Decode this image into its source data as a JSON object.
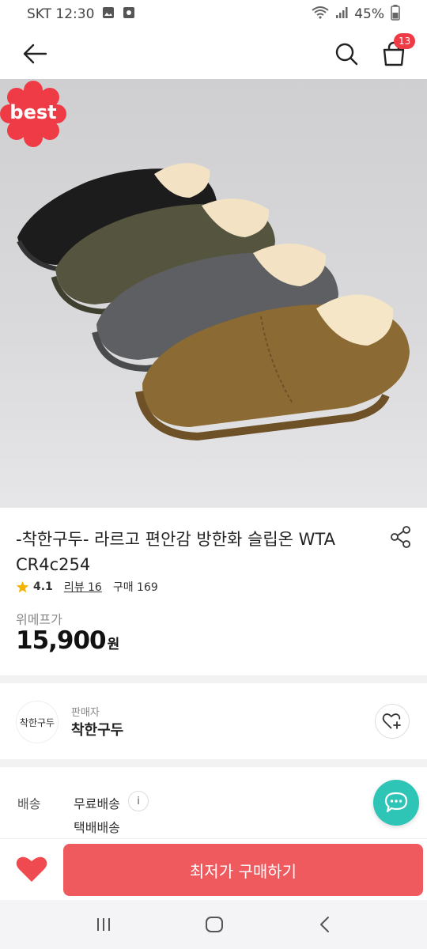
{
  "status_bar": {
    "carrier_time": "SKT 12:30",
    "battery": "45%"
  },
  "header": {
    "back_icon": "arrow-left-icon",
    "search_icon": "search-icon",
    "cart_icon": "shopping-bag-icon",
    "cart_count": "13"
  },
  "product": {
    "badge": "best",
    "title": "-착한구두- 라르고 편안감 방한화 슬립온 WTA CR4c254",
    "rating": "4.1",
    "review_text": "리뷰 16",
    "purchase_text": "구매 169",
    "price_label": "위메프가",
    "price": "15,900",
    "price_unit": "원"
  },
  "seller": {
    "logo_text": "착한구두",
    "label": "판매자",
    "name": "착한구두"
  },
  "shipping": {
    "label": "배송",
    "option1": "무료배송",
    "info_icon": "i",
    "option2": "택배배송"
  },
  "bottom_bar": {
    "buy_label": "최저가 구매하기"
  },
  "colors": {
    "accent_red": "#ef5a5f",
    "badge_red": "#ef3b46",
    "chat_teal": "#2ec4b6"
  }
}
